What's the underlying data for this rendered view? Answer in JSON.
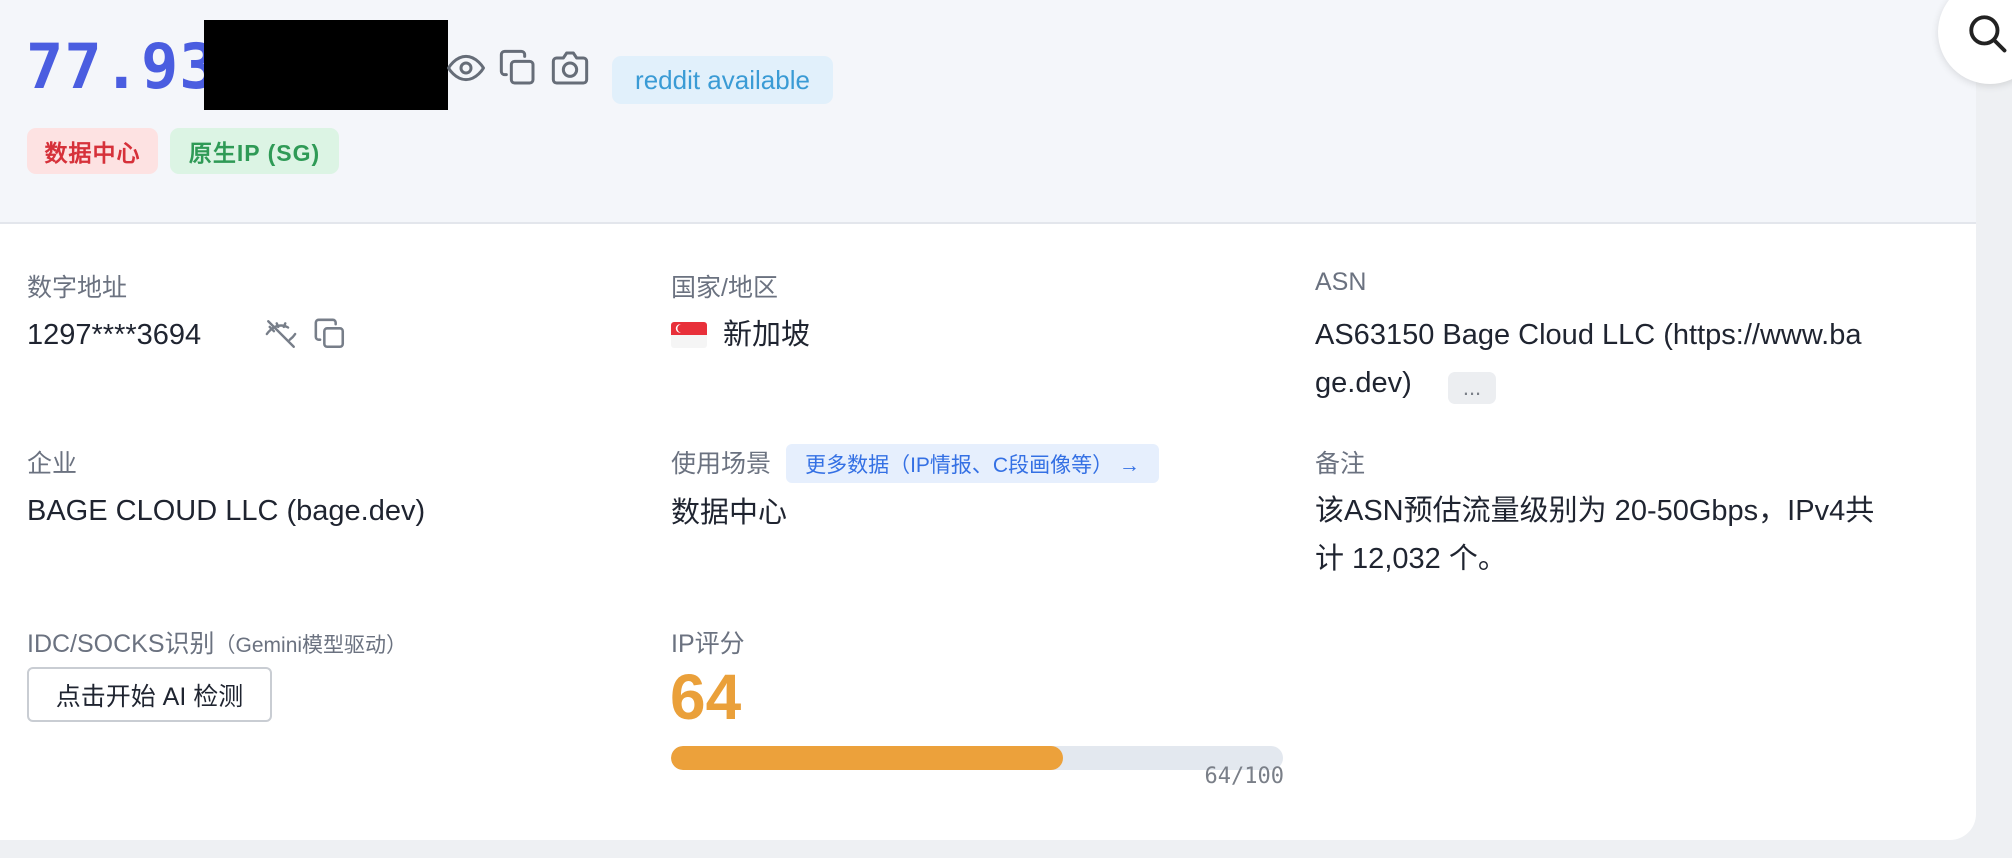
{
  "header": {
    "ip_visible": "77.93",
    "reddit_badge": "reddit available",
    "tags": {
      "datacenter": "数据中心",
      "native": "原生IP (SG)"
    }
  },
  "fields": {
    "numeric_address": {
      "label": "数字地址",
      "value": "1297****3694"
    },
    "country": {
      "label": "国家/地区",
      "value": "新加坡",
      "flag": "singapore-flag"
    },
    "asn": {
      "label": "ASN",
      "value_line1": "AS63150 Bage Cloud LLC (https://www.ba",
      "value_line2": "ge.dev)",
      "more": "..."
    },
    "company": {
      "label": "企业",
      "value": "BAGE CLOUD LLC (bage.dev)"
    },
    "usage": {
      "label": "使用场景",
      "value": "数据中心",
      "more_link": "更多数据（IP情报、C段画像等） →"
    },
    "note": {
      "label": "备注",
      "value_line1": "该ASN预估流量级别为 20-50Gbps，IPv4共",
      "value_line2": "计 12,032 个。"
    },
    "idc": {
      "label": "IDC/SOCKS识别",
      "label_sub": "（Gemini模型驱动）",
      "button": "点击开始 AI 检测"
    },
    "score": {
      "label": "IP评分",
      "value": "64",
      "bar_text": "64/100",
      "max": 100
    }
  },
  "colors": {
    "ip_text": "#4a5de0",
    "score": "#eaa03a",
    "datacenter_tag": "#d6313a",
    "native_tag": "#2f9a56",
    "link": "#3470e4"
  },
  "icons": [
    "eye-icon",
    "copy-icon",
    "camera-icon",
    "eye-off-icon",
    "search-icon",
    "arrow-right-icon"
  ]
}
